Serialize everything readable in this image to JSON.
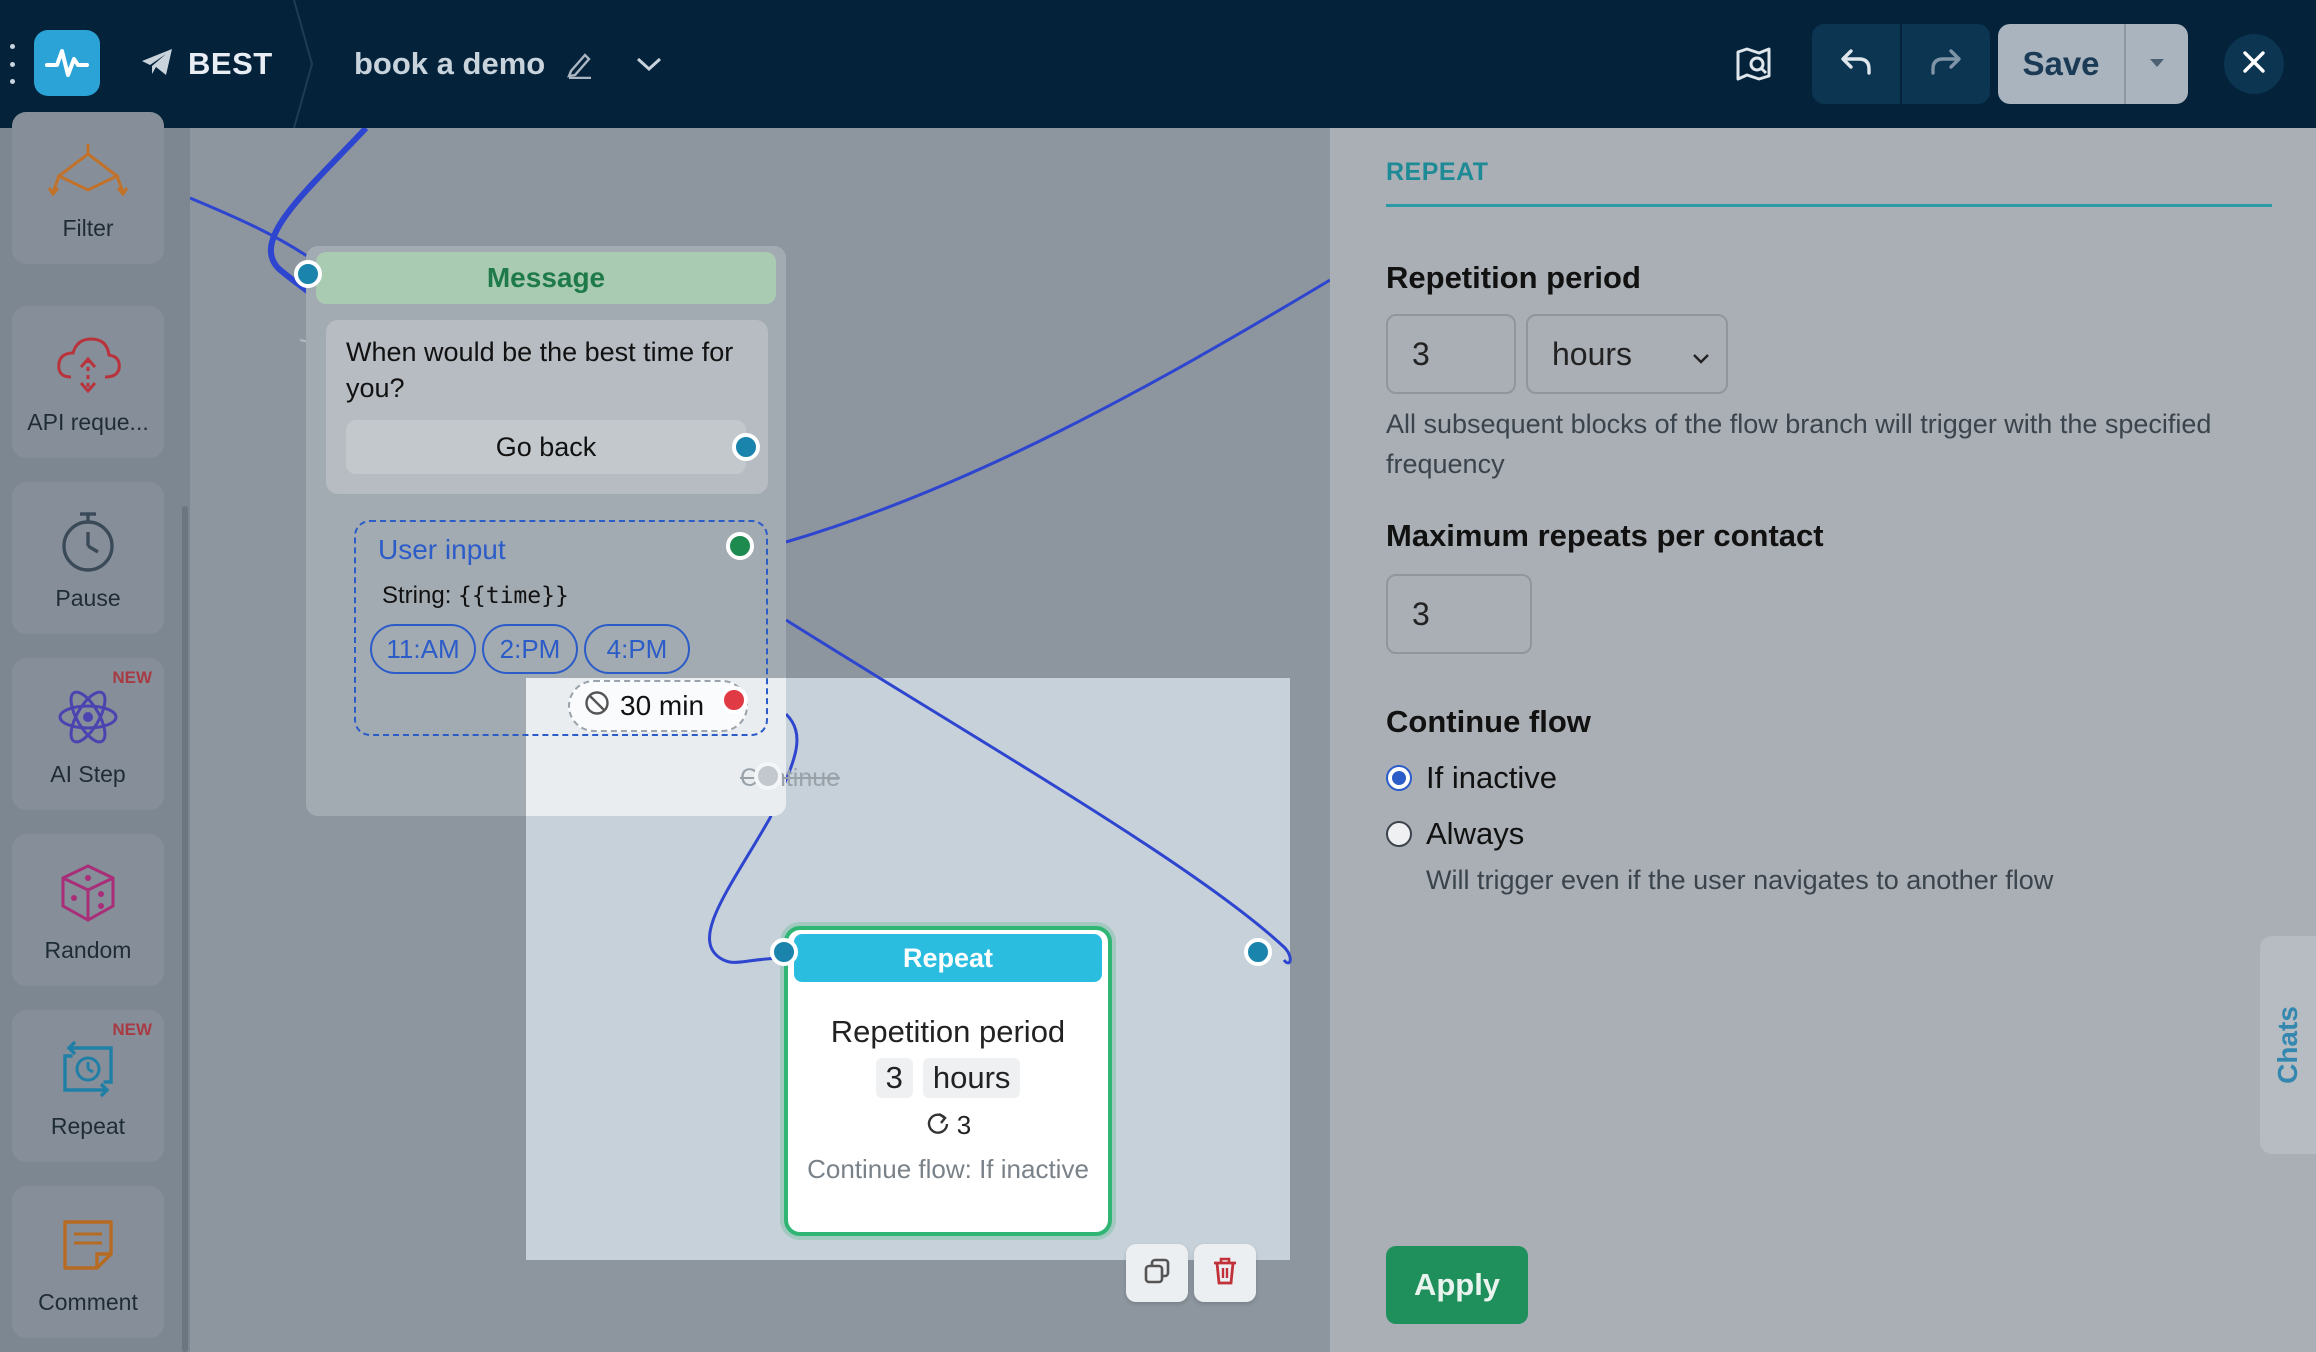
{
  "topbar": {
    "bot_name": "BEST",
    "flow_name": "book a demo",
    "save_label": "Save"
  },
  "palette": {
    "items": [
      {
        "label": "Filter",
        "icon": "filter-icon",
        "is_new": false
      },
      {
        "label": "API reque...",
        "icon": "api-cloud-icon",
        "is_new": false
      },
      {
        "label": "Pause",
        "icon": "stopwatch-icon",
        "is_new": false
      },
      {
        "label": "AI Step",
        "icon": "atom-icon",
        "is_new": true
      },
      {
        "label": "Random",
        "icon": "dice-icon",
        "is_new": false
      },
      {
        "label": "Repeat",
        "icon": "repeat-icon",
        "is_new": true
      },
      {
        "label": "Comment",
        "icon": "note-icon",
        "is_new": false
      }
    ],
    "new_badge": "NEW"
  },
  "canvas": {
    "message_node": {
      "title": "Message",
      "text": "When would be the best time for you?",
      "button": "Go back",
      "user_input_title": "User input",
      "string_prefix": "String:",
      "variable": "{{time}}",
      "chips": [
        "11:AM",
        "2:PM",
        "4:PM"
      ],
      "timeout": "30 min",
      "continue_label": "Continue"
    },
    "repeat_node": {
      "title": "Repeat",
      "period_label": "Repetition period",
      "value": "3",
      "unit": "hours",
      "max_repeats": "3",
      "continue_text": "Continue flow: If inactive"
    }
  },
  "panel": {
    "tab": "REPEAT",
    "period_heading": "Repetition period",
    "period_value": "3",
    "period_unit": "hours",
    "period_help": "All subsequent blocks of the flow branch will trigger with the specified frequency",
    "max_heading": "Maximum repeats per contact",
    "max_value": "3",
    "continue_heading": "Continue flow",
    "options": [
      {
        "label": "If inactive",
        "selected": true
      },
      {
        "label": "Always",
        "selected": false
      }
    ],
    "always_help": "Will trigger even if the user navigates to another flow",
    "apply_label": "Apply",
    "chats_tab": "Chats"
  },
  "colors": {
    "topbar_bg": "#04223a",
    "accent_green": "#1f8f5c",
    "repeat_header": "#2bbde0",
    "link_blue": "#2b5cc8"
  }
}
